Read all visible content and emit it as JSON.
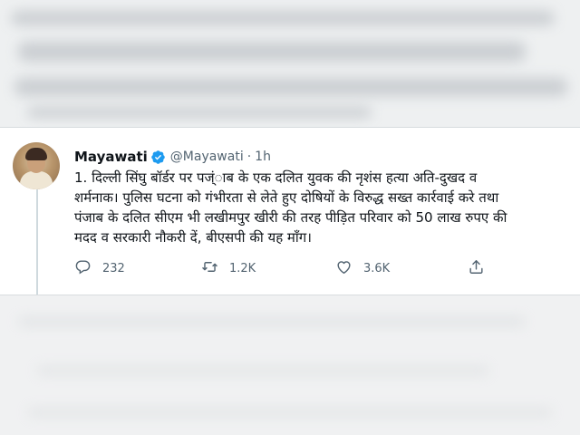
{
  "tweet": {
    "author_name": "Mayawati",
    "handle": "@Mayawati",
    "separator": "·",
    "time": "1h",
    "text_lines": [
      "1. दिल्ली सिंघु बॉर्डर पर पज्ंाब के एक दलित युवक की नृशंस हत्या अति-दुखद व",
      "शर्मनाक। पुलिस घटना को  गंभीरता से लेते हुए दोषियों के विरुद्ध सख्त कार्रवाई करे तथा",
      "पंजाब के दलित सीएम भी लखीमपुर खीरी की तरह पीड़ित परिवार को 50 लाख रुपए की",
      "मदद व सरकारी नौकरी दें, बीएसपी की यह माँग।"
    ],
    "actions": {
      "reply_count": "232",
      "retweet_count": "1.2K",
      "like_count": "3.6K"
    },
    "icons": {
      "verified": "verified-badge-icon",
      "reply": "reply-icon",
      "retweet": "retweet-icon",
      "like": "heart-icon",
      "share": "share-icon"
    },
    "colors": {
      "verified": "#1d9bf0",
      "text": "#0f1419",
      "muted": "#536471"
    }
  }
}
